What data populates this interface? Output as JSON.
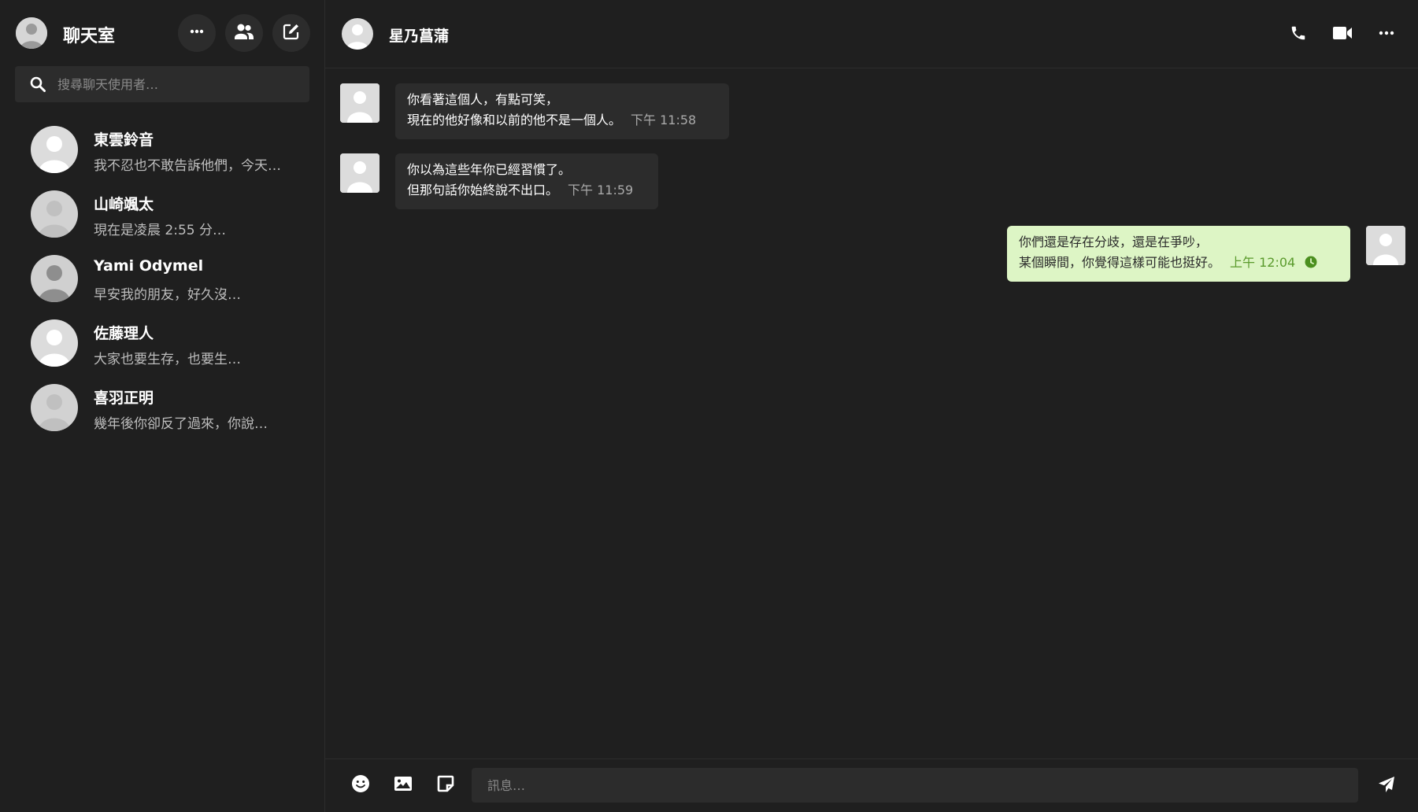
{
  "sidebar": {
    "title": "聊天室",
    "actions": [
      "more-icon",
      "people-icon",
      "compose-icon"
    ],
    "search": {
      "placeholder": "搜尋聊天使用者…"
    },
    "chats": [
      {
        "name": "東雲鈴音",
        "preview": "我不忍也不敢告訴他們，今天…"
      },
      {
        "name": "山崎颯太",
        "preview": "現在是凌晨 2:55 分…"
      },
      {
        "name": "Yami Odymel",
        "preview": "早安我的朋友，好久沒…"
      },
      {
        "name": "佐藤理人",
        "preview": "大家也要生存，也要生…"
      },
      {
        "name": "喜羽正明",
        "preview": "幾年後你卻反了過來，你說…"
      }
    ]
  },
  "header": {
    "peer_name": "星乃菖蒲",
    "actions": [
      "phone-icon",
      "video-icon",
      "more-icon"
    ]
  },
  "messages": [
    {
      "direction": "in",
      "lines": [
        "你看著這個人，有點可笑，",
        "現在的他好像和以前的他不是一個人。"
      ],
      "time": "下午 11:58"
    },
    {
      "direction": "in",
      "lines": [
        "你以為這些年你已經習慣了。",
        "但那句話你始終說不出口。"
      ],
      "time": "下午 11:59"
    },
    {
      "direction": "out",
      "lines": [
        "你們還是存在分歧，還是在爭吵，",
        "某個瞬間，你覺得這樣可能也挺好。"
      ],
      "time": "上午 12:04",
      "status_icon": "clock-icon"
    }
  ],
  "composer": {
    "placeholder": "訊息…",
    "tools": [
      "emoji-icon",
      "image-icon",
      "sticker-icon"
    ],
    "send_icon": "send-icon"
  },
  "colors": {
    "background": "#1f1f1f",
    "panel": "#2c2c2c",
    "outgoing_bubble": "#ddf5c5",
    "outgoing_time": "#5a9a2c",
    "avatar": "#d6d6d6"
  }
}
